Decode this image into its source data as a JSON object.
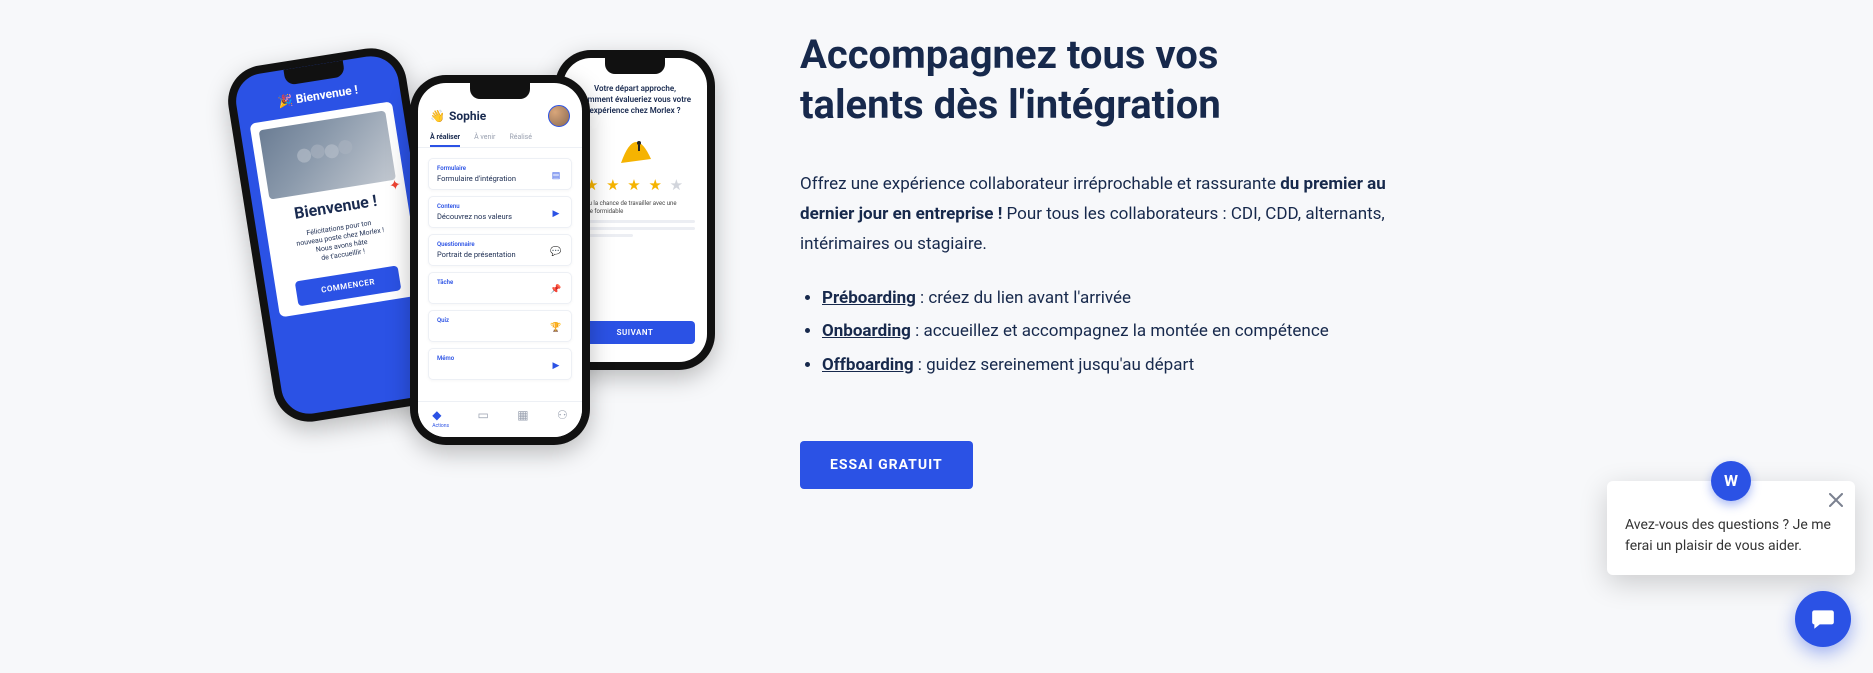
{
  "heading_line1": "Accompagnez tous vos",
  "heading_line2": "talents dès l'intégration",
  "paragraph_lead": "Offrez une expérience collaborateur irréprochable et rassurante ",
  "paragraph_bold": "du premier au dernier jour en entreprise !",
  "paragraph_tail": " Pour tous les collaborateurs : CDI, CDD, alternants, intérimaires ou stagiaire.",
  "features": [
    {
      "term": "Préboarding",
      "desc": " : créez du lien avant l'arrivée"
    },
    {
      "term": "Onboarding",
      "desc": " : accueillez et accompagnez la montée en compétence"
    },
    {
      "term": "Offboarding",
      "desc": " : guidez sereinement jusqu'au départ"
    }
  ],
  "cta_label": "ESSAI GRATUIT",
  "chat": {
    "avatar_letter": "W",
    "text": "Avez-vous des questions ? Je me ferai un plaisir de vous aider."
  },
  "phone1": {
    "header": "🎉 Bienvenue !",
    "title": "Bienvenue !",
    "sub1": "Félicitations pour ton",
    "sub2": "nouveau poste chez Morlex !",
    "sub3": "Nous avons hâte",
    "sub4": "de t'accueillir !",
    "button": "COMMENCER"
  },
  "phone2": {
    "wave": "👋",
    "name": "Sophie",
    "tabs": {
      "t1": "À réaliser",
      "t2": "À venir",
      "t3": "Réalisé"
    },
    "items": [
      {
        "cat": "Formulaire",
        "label": "Formulaire d'intégration"
      },
      {
        "cat": "Contenu",
        "label": "Découvrez nos valeurs"
      },
      {
        "cat": "Questionnaire",
        "label": "Portrait de présentation"
      },
      {
        "cat": "Tâche",
        "label": ""
      },
      {
        "cat": "Quiz",
        "label": ""
      },
      {
        "cat": "Mémo",
        "label": ""
      }
    ],
    "nav_label": "Actions"
  },
  "phone3": {
    "question_l1": "Votre départ approche,",
    "question_l2": "comment évalueriez vous votre",
    "question_l3": "expérience chez Morlex ?",
    "rating": 4,
    "answer": "J'ai eu la chance de travailler avec une équipe formidable",
    "button": "SUIVANT"
  }
}
